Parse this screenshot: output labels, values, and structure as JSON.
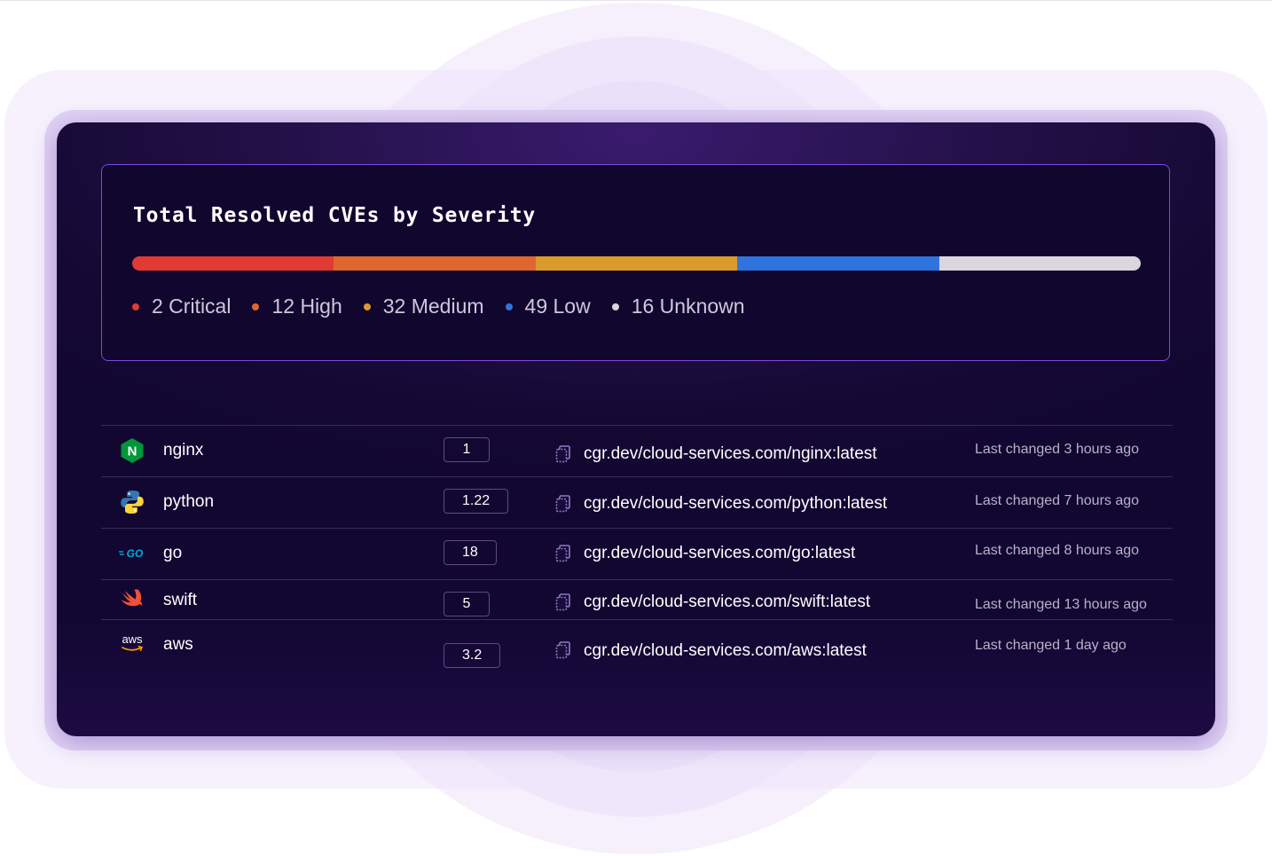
{
  "cve_summary": {
    "title": "Total Resolved CVEs by Severity",
    "severities": [
      {
        "label": "2 Critical",
        "count": 2,
        "color": "#e13a35"
      },
      {
        "label": "12 High",
        "count": 12,
        "color": "#e06630"
      },
      {
        "label": "32 Medium",
        "count": 32,
        "color": "#dc9a2c"
      },
      {
        "label": "49 Low",
        "count": 49,
        "color": "#2f73de"
      },
      {
        "label": "16 Unknown",
        "count": 16,
        "color": "#d9d6de"
      }
    ],
    "bar_segments": [
      {
        "severity": "Critical",
        "fraction": 0.2,
        "color": "#e13a35"
      },
      {
        "severity": "High",
        "fraction": 0.2,
        "color": "#e06630"
      },
      {
        "severity": "Medium",
        "fraction": 0.2,
        "color": "#dc9a2c"
      },
      {
        "severity": "Low",
        "fraction": 0.2,
        "color": "#2f73de"
      },
      {
        "severity": "Unknown",
        "fraction": 0.2,
        "color": "#d9d6de"
      }
    ]
  },
  "images": [
    {
      "icon": "nginx-icon",
      "name": "nginx",
      "version": "1",
      "reference": "cgr.dev/cloud-services.com/nginx:latest",
      "last_changed": "Last changed 3 hours ago"
    },
    {
      "icon": "python-icon",
      "name": "python",
      "version": "1.22",
      "reference": "cgr.dev/cloud-services.com/python:latest",
      "last_changed": "Last changed 7 hours ago"
    },
    {
      "icon": "go-icon",
      "name": "go",
      "version": "18",
      "reference": "cgr.dev/cloud-services.com/go:latest",
      "last_changed": "Last changed 8 hours ago"
    },
    {
      "icon": "swift-icon",
      "name": "swift",
      "version": "5",
      "reference": "cgr.dev/cloud-services.com/swift:latest",
      "last_changed": "Last changed 13 hours ago"
    },
    {
      "icon": "aws-icon",
      "name": "aws",
      "version": "3.2",
      "reference": "cgr.dev/cloud-services.com/aws:latest",
      "last_changed": "Last changed 1 day ago"
    }
  ],
  "icon_text": {
    "nginx": "N",
    "go": "GO",
    "aws": "aws"
  },
  "theme": {
    "panel": "#1b0c3d",
    "card_border": "#7d4be0",
    "nginx_green": "#009639",
    "python_blue": "#3776ab",
    "python_yellow": "#ffd43b",
    "go_cyan": "#00add8",
    "swift_orange": "#f05138",
    "aws_orange": "#ff9900"
  }
}
